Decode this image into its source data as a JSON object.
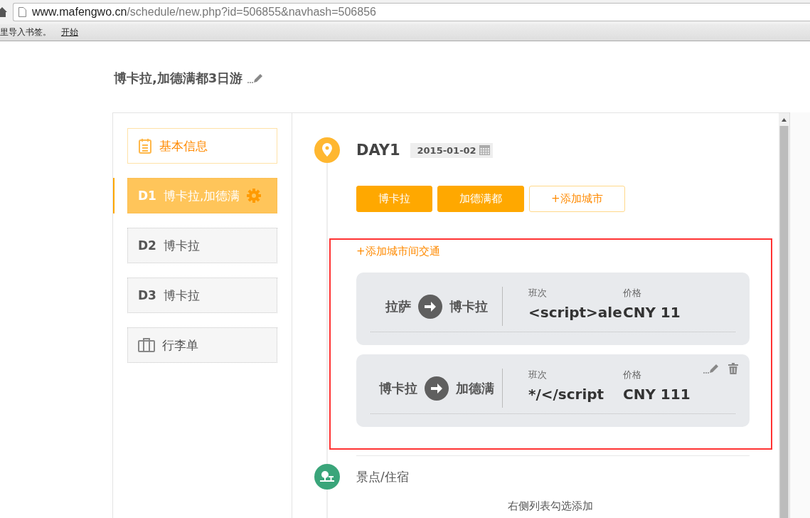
{
  "browser": {
    "url_host": "www.mafengwo.cn",
    "url_path": "/schedule/new.php?id=506855&navhash=506856",
    "bookmark_hint": "里导入书签。",
    "bookmark_link": "开始"
  },
  "trip_title": "博卡拉,加德满都3日游",
  "sidebar": [
    {
      "kind": "info",
      "label": "基本信息",
      "selected": false
    },
    {
      "kind": "day",
      "day": "D1",
      "label": "博卡拉,加德满",
      "selected": true
    },
    {
      "kind": "day",
      "day": "D2",
      "label": "博卡拉",
      "selected": false
    },
    {
      "kind": "day",
      "day": "D3",
      "label": "博卡拉",
      "selected": false
    },
    {
      "kind": "luggage",
      "label": "行李单",
      "selected": false
    }
  ],
  "day": {
    "title": "DAY1",
    "date": "2015-01-02",
    "cities": [
      {
        "kind": "city",
        "label": "博卡拉"
      },
      {
        "kind": "city",
        "label": "加德满都"
      },
      {
        "kind": "add",
        "label": "+添加城市"
      }
    ],
    "add_transport": "+添加城市间交通",
    "transports": [
      {
        "from": "拉萨",
        "to": "博卡拉",
        "shift_label": "班次",
        "price_label": "价格",
        "shift": "<script>ale",
        "price": "CNY 11",
        "hovered": false
      },
      {
        "from": "博卡拉",
        "to": "加德满",
        "shift_label": "班次",
        "price_label": "价格",
        "shift": "*/</script",
        "price": "CNY 111",
        "hovered": true
      }
    ],
    "poi_title": "景点/住宿",
    "poi_hint": "右侧列表勾选添加"
  }
}
